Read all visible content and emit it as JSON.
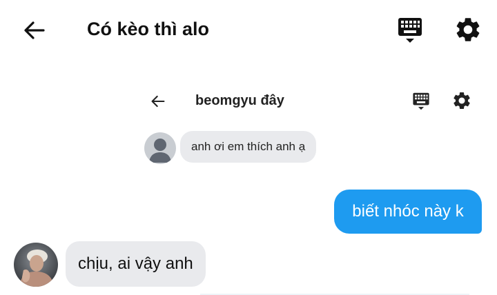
{
  "header": {
    "title": "Có kèo thì alo",
    "back_icon": "arrow-left-icon",
    "keyboard_icon": "keyboard-icon",
    "settings_icon": "gear-icon"
  },
  "embedded_chat": {
    "header_title": "beomgyu đây",
    "incoming_message": "anh ơi em thích anh ạ"
  },
  "messages": [
    {
      "side": "outgoing",
      "text": "biết nhóc này k"
    },
    {
      "side": "incoming",
      "text": "chịu, ai vậy anh"
    }
  ],
  "colors": {
    "outgoing_bubble": "#1e9bf0",
    "incoming_bubble": "#e9eaed",
    "background": "#ffffff"
  }
}
